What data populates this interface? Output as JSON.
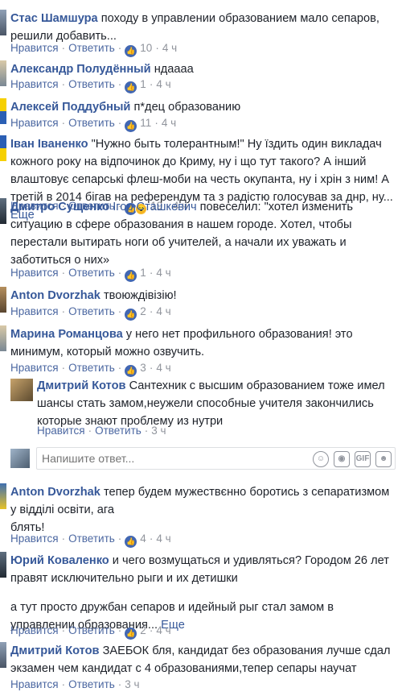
{
  "labels": {
    "like": "Нравится",
    "reply": "Ответить",
    "sep": "·",
    "more": "Еще"
  },
  "comments": [
    {
      "author": "Стас Шамшура",
      "text": "походу в управлении образованием мало сепаров, решили добавить...",
      "likes": "10",
      "time": "4 ч"
    },
    {
      "author": "Александр Полудённый",
      "text": "ндаааа",
      "likes": "1",
      "time": "4 ч"
    },
    {
      "author": "Алексей Поддубный",
      "text": "п*дец образованию",
      "likes": "11",
      "time": "4 ч"
    },
    {
      "author": "Іван Іваненко",
      "text": "\"Нужно быть толерантным!\" Ну їздить один викладач кожного року на відпочинок до Криму, ну і що тут такого? А інший влаштовує сепарські флеш-моби на честь окупанта, ну і хрін з ним! А третій в 2014 бігав на референдум та з радістю голосував за днр, ну...",
      "likes": "19",
      "time": "4 ч"
    },
    {
      "author": "Дмитро Сущенко",
      "mention": "Ігор Сташкевич",
      "text": "повеселил: \"хотел изменить ситуацию в сфере образования в нашем городе. Хотел, чтобы перестали вытирать ноги об учителей, а начали их уважать и заботиться о них»",
      "likes": "1",
      "time": "4 ч"
    },
    {
      "author": "Anton Dvorzhak",
      "text": "твоюждівізію!",
      "likes": "2",
      "time": "4 ч"
    },
    {
      "author": "Марина Романцова",
      "text": "у него нет профильного образования! это минимум, который можно озвучить.",
      "likes": "3",
      "time": "4 ч"
    },
    {
      "author": "Дмитрий Котов",
      "text": "Сантехник с высшим образованием тоже имел шансы стать замом,неужели способные учителя закончились которые знают проблему из нутри",
      "time": "3 ч"
    },
    {
      "author": "Anton Dvorzhak",
      "text": "тепер будем мужествєнно боротись з сепаратизмом у відділі освіти, ага",
      "text2": "блять!",
      "likes": "4",
      "time": "4 ч"
    },
    {
      "author": "Юрий Коваленко",
      "text": "и чего возмущаться и удивляться? Городом 26 лет правят исключительно рыги и их детишки",
      "text2": "а тут просто дружбан сепаров и идейный рыг стал замом в управлении образования...",
      "likes": "2",
      "time": "4 ч"
    },
    {
      "author": "Дмитрий Котов",
      "text": "ЗАЕБОК бля, кандидат без образования лучше сдал экзамен чем кандидат с 4 образованиями,тепер сепары научат",
      "time": "3 ч"
    }
  ],
  "reply_box": {
    "placeholder": "Напишите ответ..."
  },
  "icons": [
    "thumbs-up-icon",
    "wow-icon",
    "smiley-icon",
    "camera-icon",
    "gif-icon",
    "sticker-icon"
  ],
  "colors": {
    "link": "#365899",
    "meta": "#90949c",
    "like": "#4267b2"
  }
}
